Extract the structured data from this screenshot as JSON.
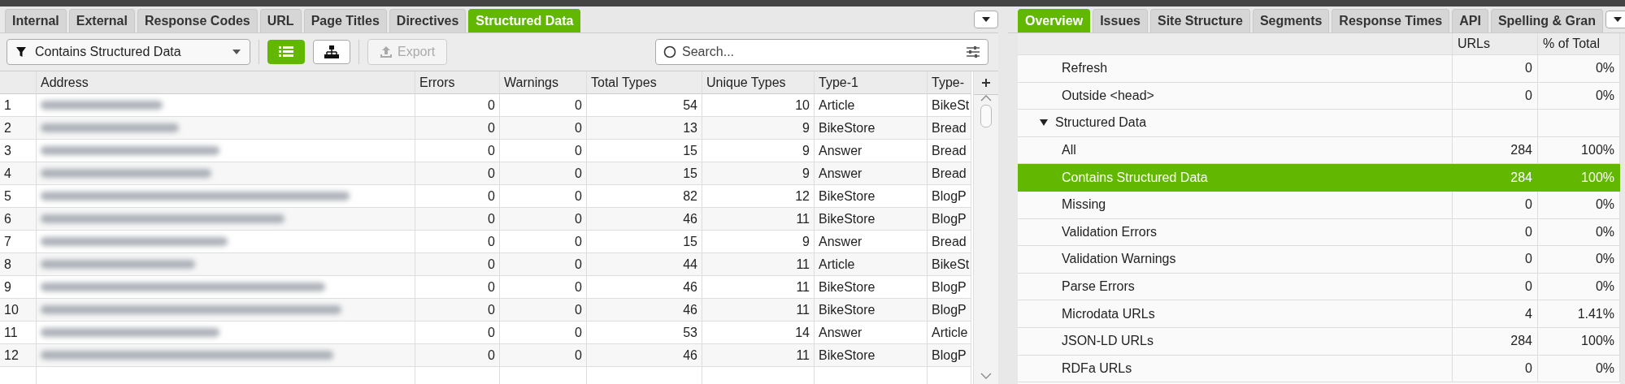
{
  "left_panel": {
    "tabs": [
      {
        "label": "Internal",
        "selected": false
      },
      {
        "label": "External",
        "selected": false
      },
      {
        "label": "Response Codes",
        "selected": false
      },
      {
        "label": "URL",
        "selected": false
      },
      {
        "label": "Page Titles",
        "selected": false
      },
      {
        "label": "Directives",
        "selected": false
      },
      {
        "label": "Structured Data",
        "selected": true
      }
    ],
    "toolbar": {
      "filter": "Contains Structured Data",
      "view_toggles": [
        {
          "kind": "list",
          "selected": true
        },
        {
          "kind": "tree",
          "selected": false
        }
      ],
      "export": {
        "label": "Export",
        "disabled": true
      },
      "search": {
        "placeholder": "Search..."
      }
    },
    "table": {
      "columns": [
        "Address",
        "Errors",
        "Warnings",
        "Total Types",
        "Unique Types",
        "Type-1",
        "Type-"
      ],
      "rows": [
        {
          "number": "1",
          "errors": "0",
          "warnings": "0",
          "total_types": "54",
          "unique_types": "10",
          "type_1": "Article",
          "type_2": "BikeSt"
        },
        {
          "number": "2",
          "errors": "0",
          "warnings": "0",
          "total_types": "13",
          "unique_types": "9",
          "type_1": "BikeStore",
          "type_2": "Bread"
        },
        {
          "number": "3",
          "errors": "0",
          "warnings": "0",
          "total_types": "15",
          "unique_types": "9",
          "type_1": "Answer",
          "type_2": "Bread"
        },
        {
          "number": "4",
          "errors": "0",
          "warnings": "0",
          "total_types": "15",
          "unique_types": "9",
          "type_1": "Answer",
          "type_2": "Bread"
        },
        {
          "number": "5",
          "errors": "0",
          "warnings": "0",
          "total_types": "82",
          "unique_types": "12",
          "type_1": "BikeStore",
          "type_2": "BlogP"
        },
        {
          "number": "6",
          "errors": "0",
          "warnings": "0",
          "total_types": "46",
          "unique_types": "11",
          "type_1": "BikeStore",
          "type_2": "BlogP"
        },
        {
          "number": "7",
          "errors": "0",
          "warnings": "0",
          "total_types": "15",
          "unique_types": "9",
          "type_1": "Answer",
          "type_2": "Bread"
        },
        {
          "number": "8",
          "errors": "0",
          "warnings": "0",
          "total_types": "44",
          "unique_types": "11",
          "type_1": "Article",
          "type_2": "BikeSt"
        },
        {
          "number": "9",
          "errors": "0",
          "warnings": "0",
          "total_types": "46",
          "unique_types": "11",
          "type_1": "BikeStore",
          "type_2": "BlogP"
        },
        {
          "number": "10",
          "errors": "0",
          "warnings": "0",
          "total_types": "46",
          "unique_types": "11",
          "type_1": "BikeStore",
          "type_2": "BlogP"
        },
        {
          "number": "11",
          "errors": "0",
          "warnings": "0",
          "total_types": "53",
          "unique_types": "14",
          "type_1": "Answer",
          "type_2": "Article"
        },
        {
          "number": "12",
          "errors": "0",
          "warnings": "0",
          "total_types": "46",
          "unique_types": "11",
          "type_1": "BikeStore",
          "type_2": "BlogP"
        }
      ]
    }
  },
  "right_panel": {
    "tabs": [
      {
        "label": "Overview",
        "selected": true
      },
      {
        "label": "Issues",
        "selected": false
      },
      {
        "label": "Site Structure",
        "selected": false
      },
      {
        "label": "Segments",
        "selected": false
      },
      {
        "label": "Response Times",
        "selected": false
      },
      {
        "label": "API",
        "selected": false
      },
      {
        "label": "Spelling & Gran",
        "selected": false
      }
    ],
    "columns": [
      "URLs",
      "% of Total"
    ],
    "items": [
      {
        "label": "Refresh",
        "urls": "0",
        "percent": "0%",
        "selected": false
      },
      {
        "label": "Outside <head>",
        "urls": "0",
        "percent": "0%",
        "selected": false
      },
      {
        "label": "Structured Data",
        "selected": false,
        "expanded": true,
        "children": [
          {
            "label": "All",
            "urls": "284",
            "percent": "100%",
            "selected": false
          },
          {
            "label": "Contains Structured Data",
            "urls": "284",
            "percent": "100%",
            "selected": true
          },
          {
            "label": "Missing",
            "urls": "0",
            "percent": "0%",
            "selected": false
          },
          {
            "label": "Validation Errors",
            "urls": "0",
            "percent": "0%",
            "selected": false
          },
          {
            "label": "Validation Warnings",
            "urls": "0",
            "percent": "0%",
            "selected": false
          },
          {
            "label": "Parse Errors",
            "urls": "0",
            "percent": "0%",
            "selected": false
          },
          {
            "label": "Microdata URLs",
            "urls": "4",
            "percent": "1.41%",
            "selected": false
          },
          {
            "label": "JSON-LD URLs",
            "urls": "284",
            "percent": "100%",
            "selected": false
          },
          {
            "label": "RDFa URLs",
            "urls": "0",
            "percent": "0%",
            "selected": false
          }
        ]
      }
    ]
  }
}
